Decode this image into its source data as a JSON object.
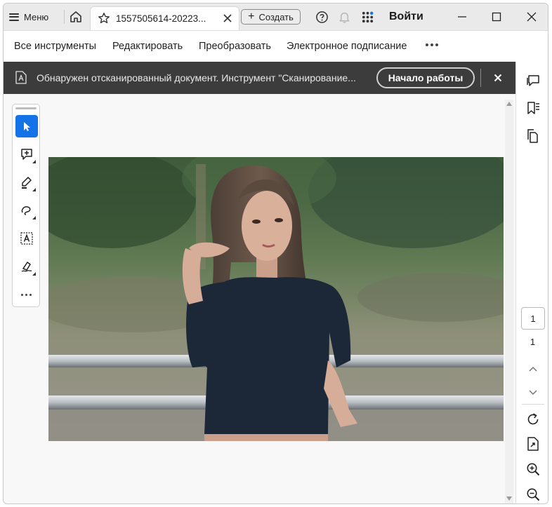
{
  "titlebar": {
    "menu_label": "Меню",
    "tab_title": "1557505614-20223...",
    "create_label": "Создать",
    "login_label": "Войти"
  },
  "menubar": {
    "items": [
      "Все инструменты",
      "Редактировать",
      "Преобразовать",
      "Электронное подписание"
    ]
  },
  "banner": {
    "message": "Обнаружен отсканированный документ. Инструмент \"Сканирование...",
    "button_label": "Начало работы"
  },
  "navigation": {
    "page_input": "1",
    "page_total": "1"
  },
  "colors": {
    "accent": "#1473e6",
    "banner_bg": "#3c3c3c",
    "titlebar_bg": "#eaeaea"
  },
  "icons": [
    "home-icon",
    "star-icon",
    "close-icon",
    "help-icon",
    "bell-icon",
    "apps-icon",
    "minimize-icon",
    "maximize-icon",
    "comment-icon",
    "bookmark-icon",
    "pages-icon",
    "rotate-icon",
    "extract-page-icon",
    "zoom-in-icon",
    "zoom-out-icon",
    "cursor-icon",
    "add-comment-icon",
    "highlight-icon",
    "draw-icon",
    "text-select-icon",
    "sign-icon"
  ]
}
